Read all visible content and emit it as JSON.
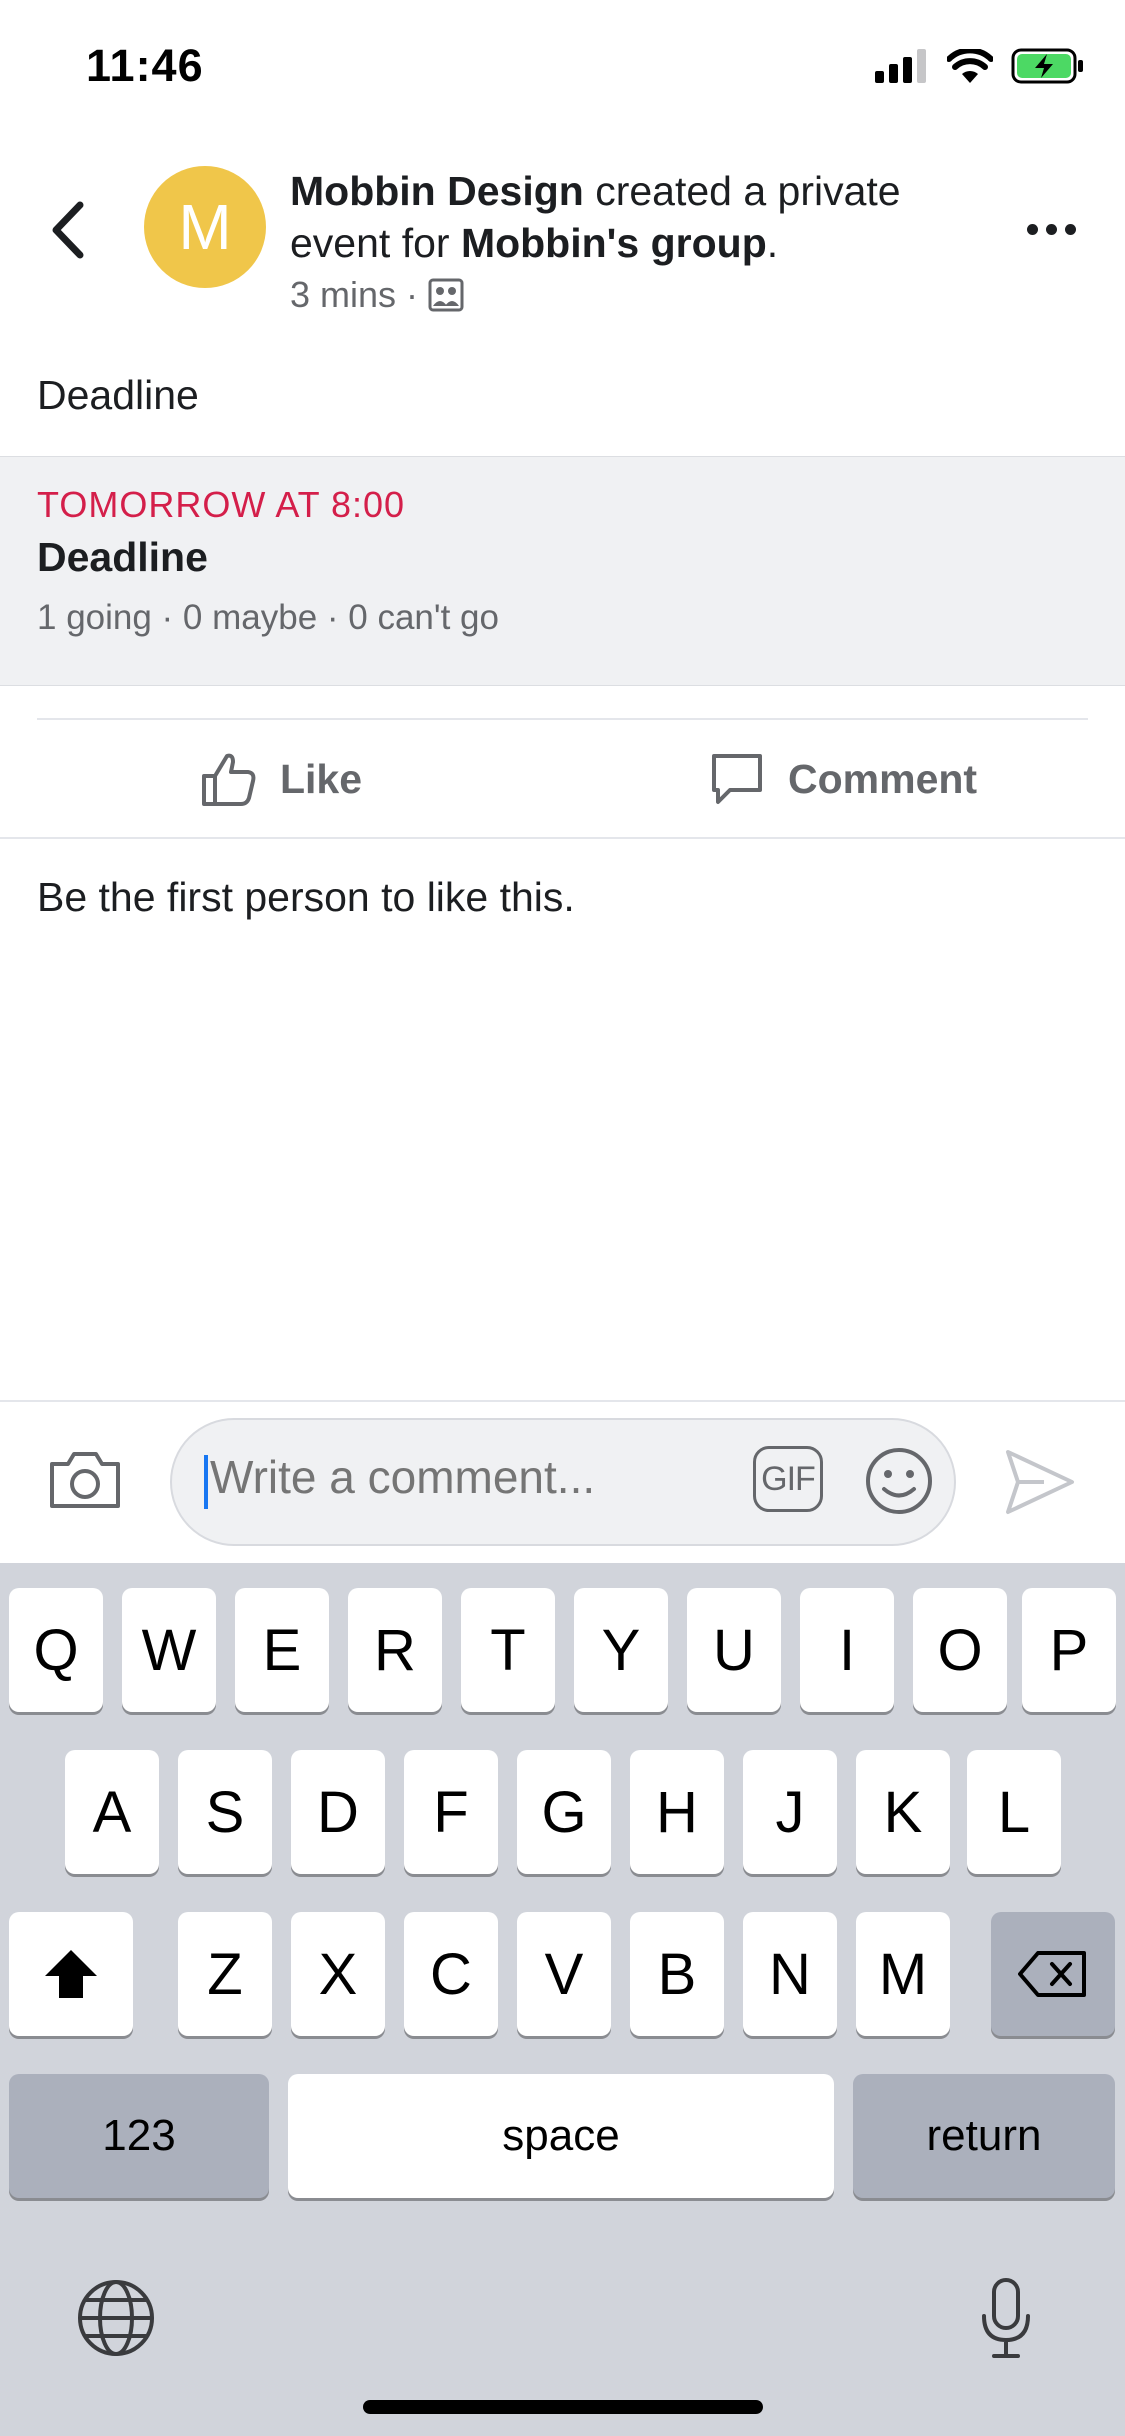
{
  "status_bar": {
    "time": "11:46"
  },
  "header": {
    "avatar_letter": "M",
    "author": "Mobbin Design",
    "action_text": " created a private event for ",
    "group": "Mobbin's group",
    "period": ".",
    "time_ago": "3 mins",
    "separator": "·"
  },
  "post": {
    "text": "Deadline"
  },
  "event": {
    "date": "TOMORROW AT 8:00",
    "title": "Deadline",
    "stats": "1 going · 0 maybe · 0 can't go"
  },
  "actions": {
    "like": "Like",
    "comment": "Comment"
  },
  "likes_text": "Be the first person to like this.",
  "comment_bar": {
    "placeholder": "Write a comment...",
    "gif": "GIF"
  },
  "keyboard": {
    "row1": [
      "Q",
      "W",
      "E",
      "R",
      "T",
      "Y",
      "U",
      "I",
      "O",
      "P"
    ],
    "row2": [
      "A",
      "S",
      "D",
      "F",
      "G",
      "H",
      "J",
      "K",
      "L"
    ],
    "row3": [
      "Z",
      "X",
      "C",
      "V",
      "B",
      "N",
      "M"
    ],
    "numbers": "123",
    "space": "space",
    "return": "return"
  },
  "colors": {
    "accent": "#1877f2",
    "event_date": "#d41f4a",
    "avatar": "#f0c64a"
  }
}
